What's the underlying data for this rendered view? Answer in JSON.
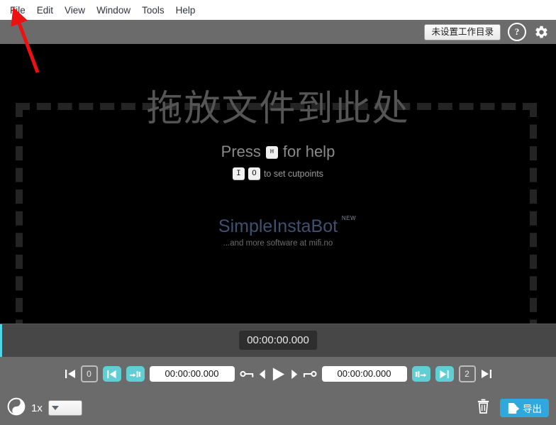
{
  "menubar": {
    "items": [
      {
        "label": "File"
      },
      {
        "label": "Edit"
      },
      {
        "label": "View"
      },
      {
        "label": "Window"
      },
      {
        "label": "Tools"
      },
      {
        "label": "Help"
      }
    ]
  },
  "topbar": {
    "working_dir_label": "未设置工作目录",
    "help_glyph": "?",
    "help_name": "help-icon",
    "settings_name": "gear-icon"
  },
  "stage": {
    "drop_title": "拖放文件到此处",
    "press_prefix": "Press",
    "press_key": "H",
    "press_suffix": "for help",
    "cut_key_in": "I",
    "cut_key_out": "O",
    "cut_text": "to set cutpoints",
    "brand_name": "SimpleInstaBot",
    "brand_badge": "NEW",
    "brand_sub": "...and more software at mifi.no"
  },
  "timeline": {
    "timecode": "00:00:00.000",
    "playhead_color": "#4fd7e8"
  },
  "controls": {
    "jump_start_name": "jump-to-start-icon",
    "segment_badge": "0",
    "prev_cut_name": "previous-cutpoint-icon",
    "set_in_name": "set-cut-start-icon",
    "start_time": "00:00:00.000",
    "key_left_name": "key-left-icon",
    "step_back_name": "step-backward-icon",
    "play_name": "play-icon",
    "step_forward_name": "step-forward-icon",
    "key_right_name": "key-right-icon",
    "end_time": "00:00:00.000",
    "set_out_name": "set-cut-end-icon",
    "next_cut_name": "next-cutpoint-icon",
    "segment_count_badge": "2",
    "jump_end_name": "jump-to-end-icon"
  },
  "bottombar": {
    "logo_name": "yin-yang-logo",
    "speed_label": "1x",
    "speed_value": "",
    "delete_name": "trash-icon",
    "export_label": "导出",
    "export_icon_name": "export-file-icon",
    "export_color": "#31a8dd"
  },
  "annotation": {
    "arrow_color": "#ee1111",
    "arrow_name": "red-pointer-arrow"
  }
}
